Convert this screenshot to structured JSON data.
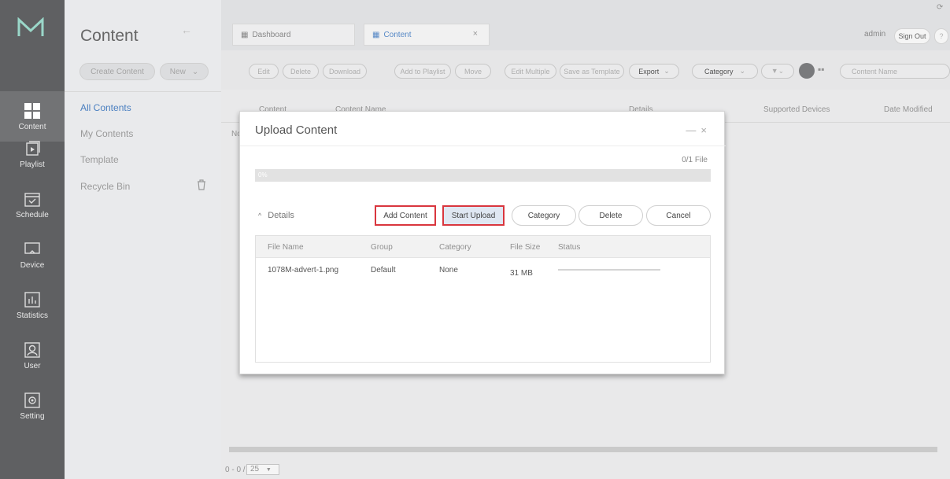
{
  "rail": {
    "logo": "M",
    "items": [
      {
        "label": "Content",
        "icon": "grid-icon",
        "active": true
      },
      {
        "label": "Playlist",
        "icon": "playlist-icon",
        "active": false
      },
      {
        "label": "Schedule",
        "icon": "calendar-icon",
        "active": false
      },
      {
        "label": "Device",
        "icon": "monitor-icon",
        "active": false
      },
      {
        "label": "Statistics",
        "icon": "bar-chart-icon",
        "active": false
      },
      {
        "label": "User",
        "icon": "user-icon",
        "active": false
      },
      {
        "label": "Setting",
        "icon": "gear-icon",
        "active": false
      }
    ]
  },
  "nav": {
    "title": "Content",
    "create_label": "Create Content",
    "new_label": "New",
    "items": [
      "All Contents",
      "My Contents",
      "Template",
      "Recycle Bin"
    ],
    "selected": "All Contents"
  },
  "tabs": [
    {
      "label": "Dashboard",
      "icon": "dashboard-icon"
    },
    {
      "label": "Content",
      "icon": "content-icon",
      "active": true
    }
  ],
  "header": {
    "user": "admin",
    "sign_out": "Sign Out",
    "help": "?"
  },
  "toolbar": {
    "buttons": [
      "Edit",
      "Delete",
      "Download",
      "Add to Playlist",
      "Move",
      "Edit Multiple",
      "Save as Template",
      "Export"
    ],
    "category": "Category",
    "search_placeholder": "Content Name"
  },
  "table": {
    "headers": [
      "Content",
      "Content Name",
      "Details",
      "Supported Devices",
      "Date Modified"
    ],
    "row_fragment": "No"
  },
  "pager": {
    "range": "0 - 0 / 0",
    "page_size": "25"
  },
  "modal": {
    "title": "Upload Content",
    "file_count": "0/1 File",
    "progress_text": "0%",
    "progress": 0,
    "details_label": "Details",
    "buttons": {
      "add": "Add Content",
      "start": "Start Upload",
      "category": "Category",
      "delete": "Delete",
      "cancel": "Cancel"
    },
    "columns": [
      "File Name",
      "Group",
      "Category",
      "File Size",
      "Status"
    ],
    "rows": [
      {
        "file_name": "1078M-advert-1.png",
        "group": "Default",
        "category": "None",
        "file_size": "31 MB"
      }
    ]
  },
  "colors": {
    "rail": "#5f6062",
    "accent": "#4a7fc0",
    "highlight": "#d9363e"
  }
}
